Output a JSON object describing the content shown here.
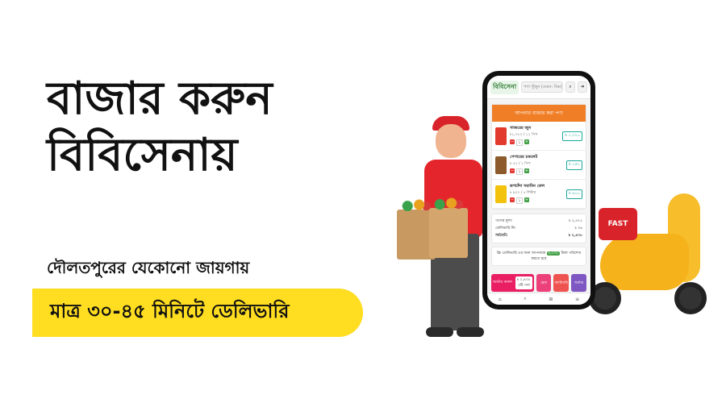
{
  "headline": {
    "line1": "বাজার করুন",
    "line2": "বিবিসেনায়"
  },
  "subline": "দৌলতপুরের যেকোনো জায়গায়",
  "pill_text": "মাত্র ৩০-৪৫ মিনিটে ডেলিভারি",
  "scooter_box_text": "FAST",
  "phone": {
    "logo": "বিবিসেনা",
    "search_placeholder": "পণ্য খুঁজুন (যেমন: ডিম)",
    "card_title": "আপনার বাজার করা পণ্য",
    "items": [
      {
        "name": "গাজরের জুস",
        "price": "৳১,৩২০ / ১২ পিস",
        "qty": "১",
        "total": "৳ ১,৩২০",
        "color": "#e23b2e"
      },
      {
        "name": "পেপারের চকলেট",
        "price": "৳ ৫২ / ১ পিস",
        "qty": "১",
        "total": "৳ ১৫২",
        "color": "#8d5a2b"
      },
      {
        "name": "রূপচাঁদা সয়াবিন তেল",
        "price": "৳ ৯০০ / ৫ লিটার",
        "qty": "১",
        "total": "৳ ৯০০",
        "color": "#f2c20c"
      }
    ],
    "summary": {
      "subtotal_label": "পণ্যের মূল্য:",
      "subtotal": "৳ ২,৩৭২",
      "delivery_label": "ডেলিভারি ফি:",
      "delivery": "৳ ৩৬",
      "total_label": "সর্বমোট:",
      "total": "৳ ২,৪০৮"
    },
    "note_before": "ফ্রি ডেলিভারি এর জন্য আপনাকে",
    "note_amount": "৳,৫৩৫",
    "note_after": "টাকা পরিশোধ করতে হবে",
    "order_label": "অর্ডার করুন",
    "order_total": "৳ ২,৪০৮",
    "order_count": "৩টি পণ্য",
    "quick_buttons": [
      "হোম",
      "ক্যাটাগরি",
      "অর্ডার"
    ]
  }
}
